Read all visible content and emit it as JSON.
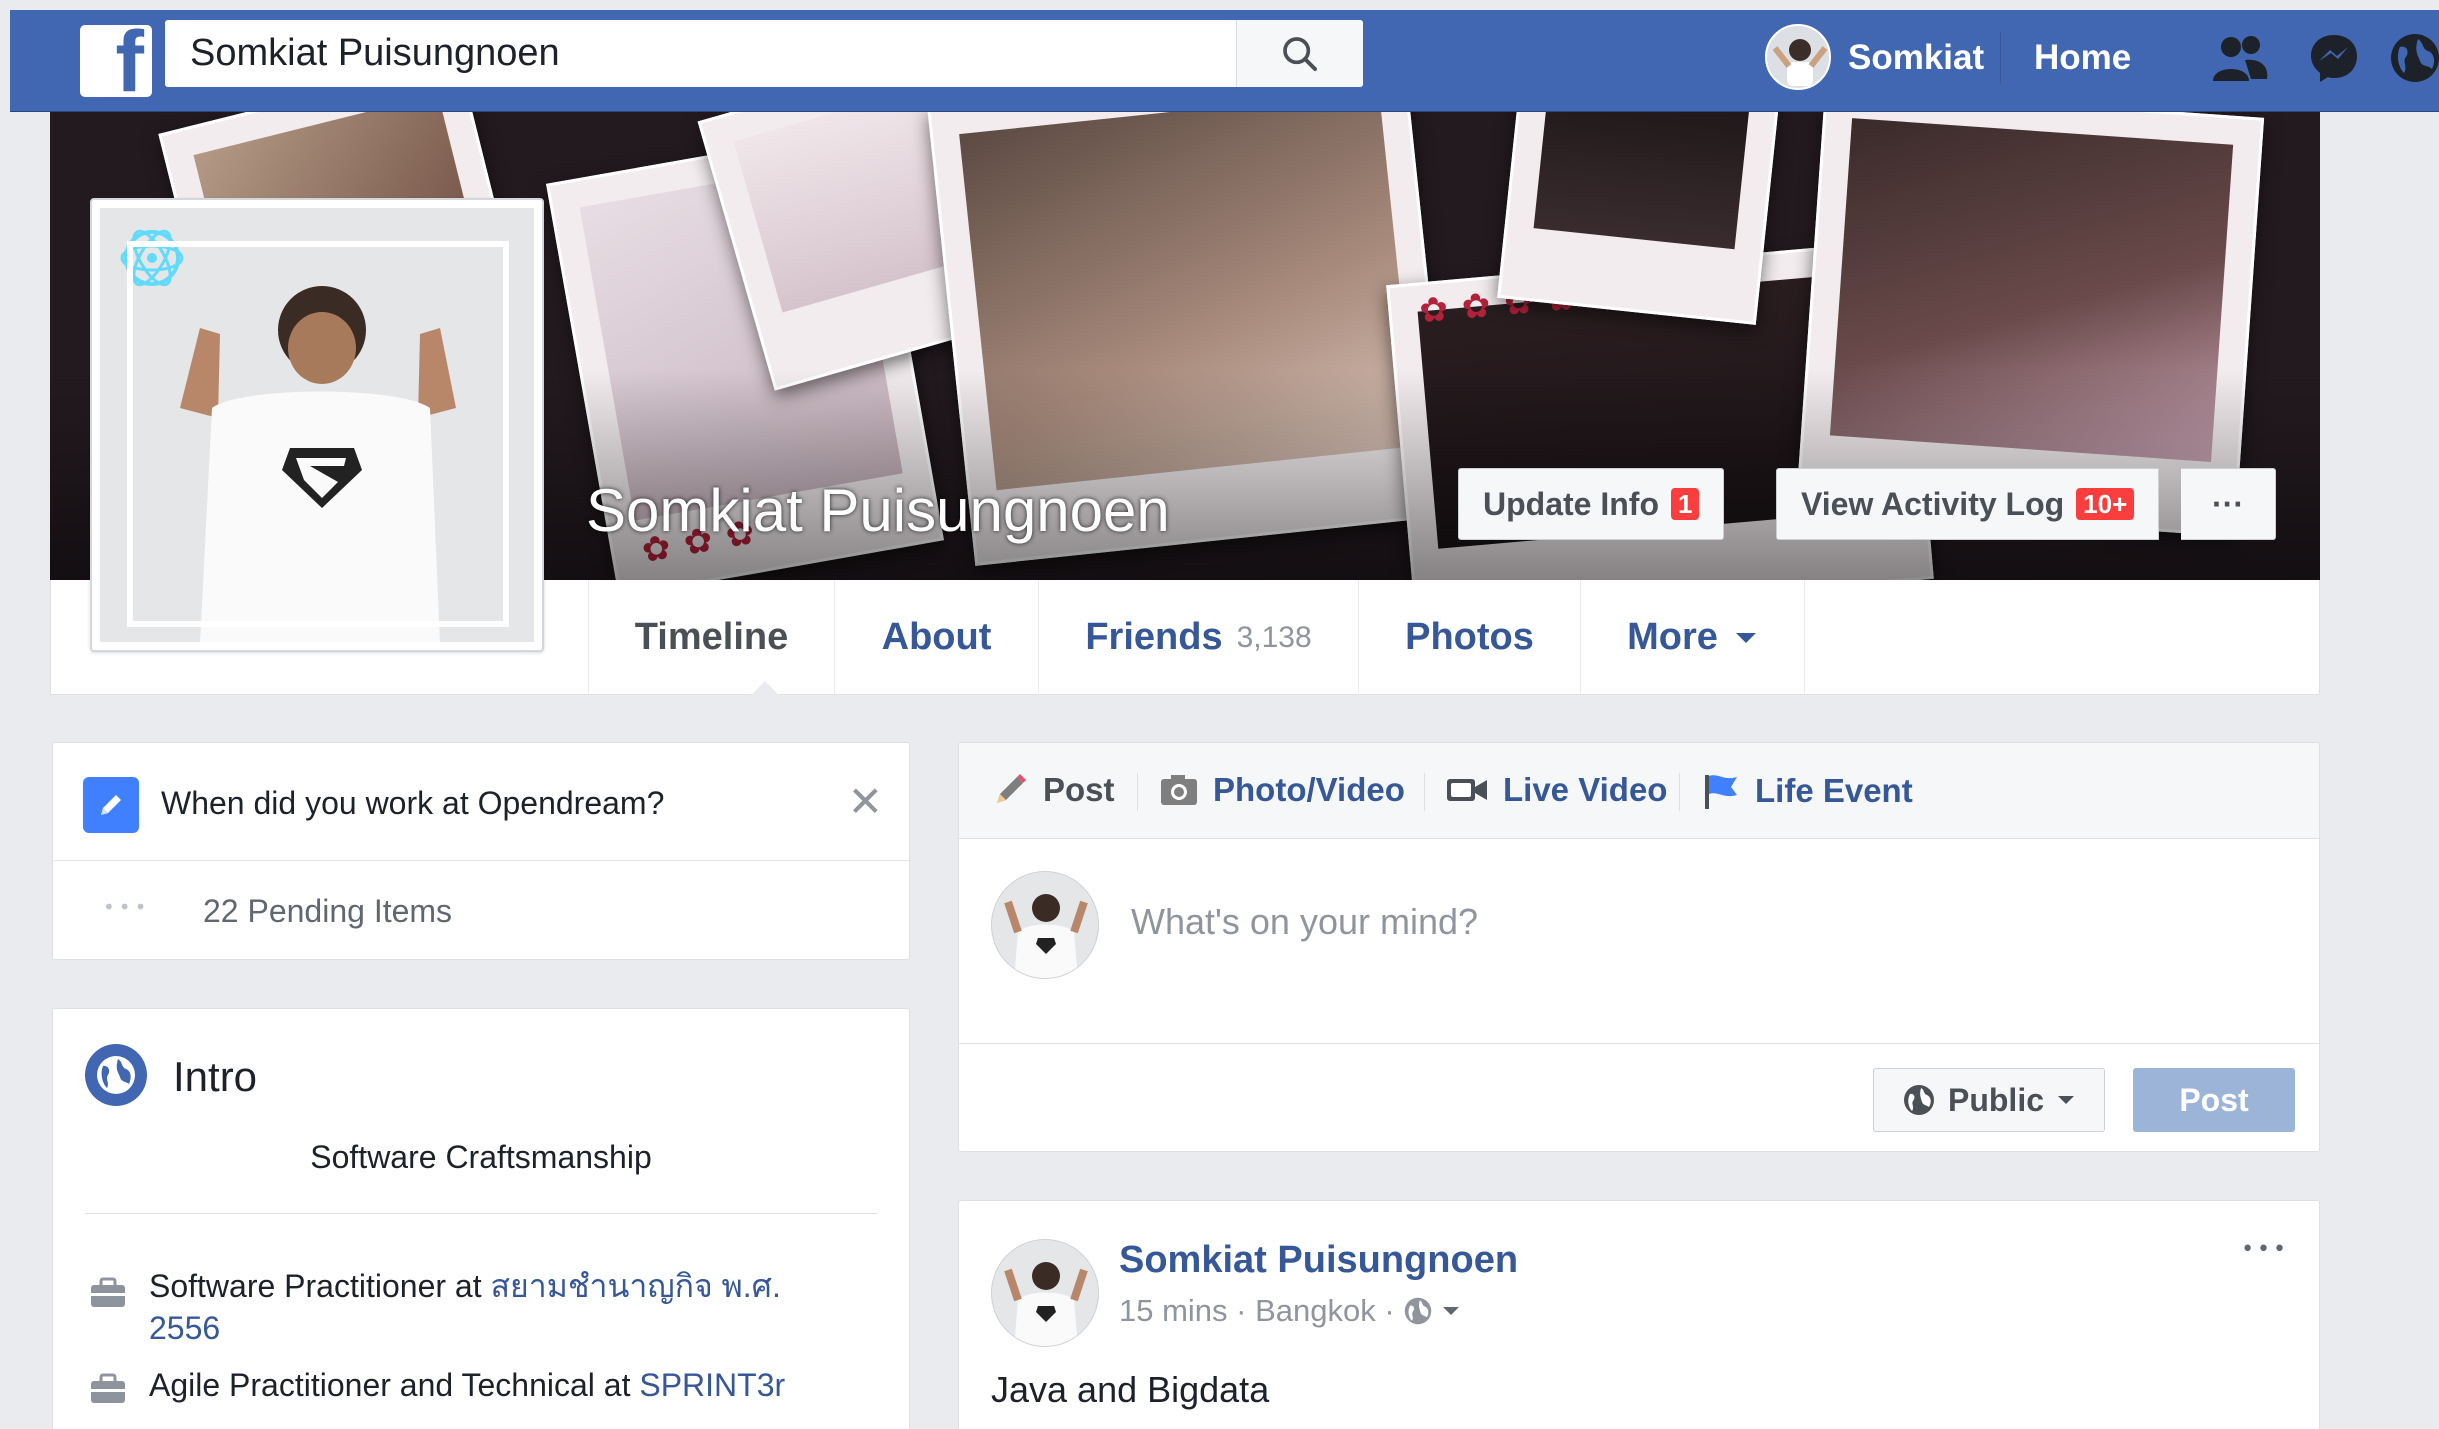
{
  "topbar": {
    "logo_letter": "f",
    "search_value": "Somkiat Puisungnoen",
    "user_name": "Somkiat",
    "home_label": "Home",
    "icons": [
      "friend-requests-icon",
      "messenger-icon",
      "notifications-globe-icon"
    ]
  },
  "cover": {
    "name": "Somkiat Puisungnoen",
    "update_info_label": "Update Info",
    "update_info_badge": "1",
    "activity_log_label": "View Activity Log",
    "activity_log_badge": "10+",
    "more_label": "···"
  },
  "nav": {
    "tabs": [
      {
        "label": "Timeline"
      },
      {
        "label": "About"
      },
      {
        "label": "Friends",
        "count": "3,138"
      },
      {
        "label": "Photos"
      },
      {
        "label": "More"
      }
    ]
  },
  "prompt_card": {
    "question": "When did you work at Opendream?",
    "close": "✕",
    "pending_dots": "•••",
    "pending": "22 Pending Items"
  },
  "intro": {
    "title": "Intro",
    "bio": "Software Craftsmanship",
    "items": [
      {
        "prefix": "Software Practitioner at ",
        "link": "สยามชำนาญกิจ พ.ศ.",
        "link2": "2556"
      },
      {
        "prefix": "Agile Practitioner and Technical at ",
        "link": "SPRINT3r"
      }
    ]
  },
  "composer": {
    "tabs": [
      "Post",
      "Photo/Video",
      "Live Video",
      "Life Event"
    ],
    "placeholder": "What's on your mind?",
    "privacy_label": "Public",
    "post_label": "Post"
  },
  "feed_post": {
    "author": "Somkiat Puisungnoen",
    "meta": "15 mins · Bangkok ·",
    "more": "•••",
    "text": "Java and Bigdata"
  },
  "colors": {
    "brand_blue": "#4267b2",
    "link_blue": "#365899",
    "badge_red": "#fa3e3e",
    "disabled_post": "#9cb4d8"
  }
}
